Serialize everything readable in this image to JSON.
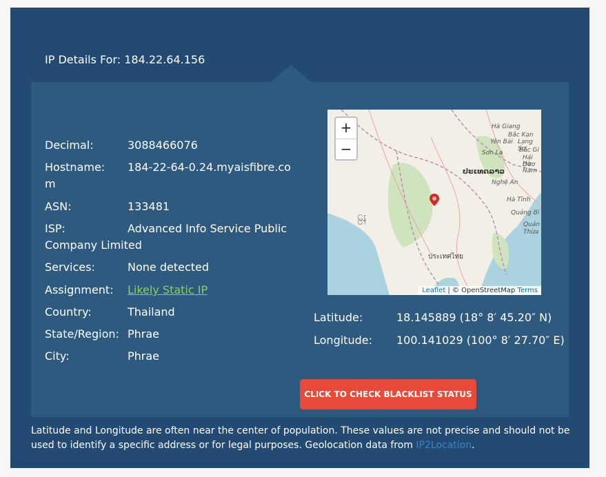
{
  "header": {
    "title": "IP Details For: 184.22.64.156"
  },
  "details": {
    "decimal": {
      "label": "Decimal:",
      "value": "3088466076"
    },
    "hostname": {
      "label": "Hostname:",
      "value": "184-22-64-0.24.myaisfibre.com"
    },
    "asn": {
      "label": "ASN:",
      "value": "133481"
    },
    "isp": {
      "label": "ISP:",
      "value": "Advanced Info Service Public Company Limited"
    },
    "services": {
      "label": "Services:",
      "value": "None detected"
    },
    "assignment": {
      "label": "Assignment:",
      "value": "Likely Static IP"
    },
    "country": {
      "label": "Country:",
      "value": "Thailand"
    },
    "state": {
      "label": "State/Region:",
      "value": "Phrae"
    },
    "city": {
      "label": "City:",
      "value": "Phrae"
    }
  },
  "map": {
    "zoom_in": "+",
    "zoom_out": "−",
    "attribution_leaflet": "Leaflet",
    "attribution_sep": " | © OpenStreetMap ",
    "attribution_terms": "Terms",
    "labels": [
      "Hà Giang",
      "Bắc Kạn",
      "Yên Bái",
      "Lạng Sơ",
      "Sơn La",
      "Bắc Gi",
      "Hải Dươ",
      "Hà Nam",
      "ປະເທດລາວ",
      "Nghệ An",
      "Hà Tĩnh",
      "Quảng Bì",
      "Quản",
      "Thừa",
      "ประเทศไทย",
      "မြန်"
    ]
  },
  "coords": {
    "latitude": {
      "label": "Latitude:",
      "value": "18.145889  (18° 8′ 45.20″ N)"
    },
    "longitude": {
      "label": "Longitude:",
      "value": "100.141029  (100° 8′ 27.70″ E)"
    }
  },
  "button": {
    "label": "CLICK TO CHECK BLACKLIST STATUS"
  },
  "footer": {
    "text": "Latitude and Longitude are often near the center of population. These values are not precise and should not be used to identify a specific address or for legal purposes. Geolocation data from ",
    "link": "IP2Location",
    "end": "."
  },
  "colors": {
    "outer_bg": "#234a72",
    "panel_bg": "#2f5a80",
    "button": "#e74a3b",
    "link_green": "#8fd05a",
    "link_blue": "#3b83c5"
  }
}
